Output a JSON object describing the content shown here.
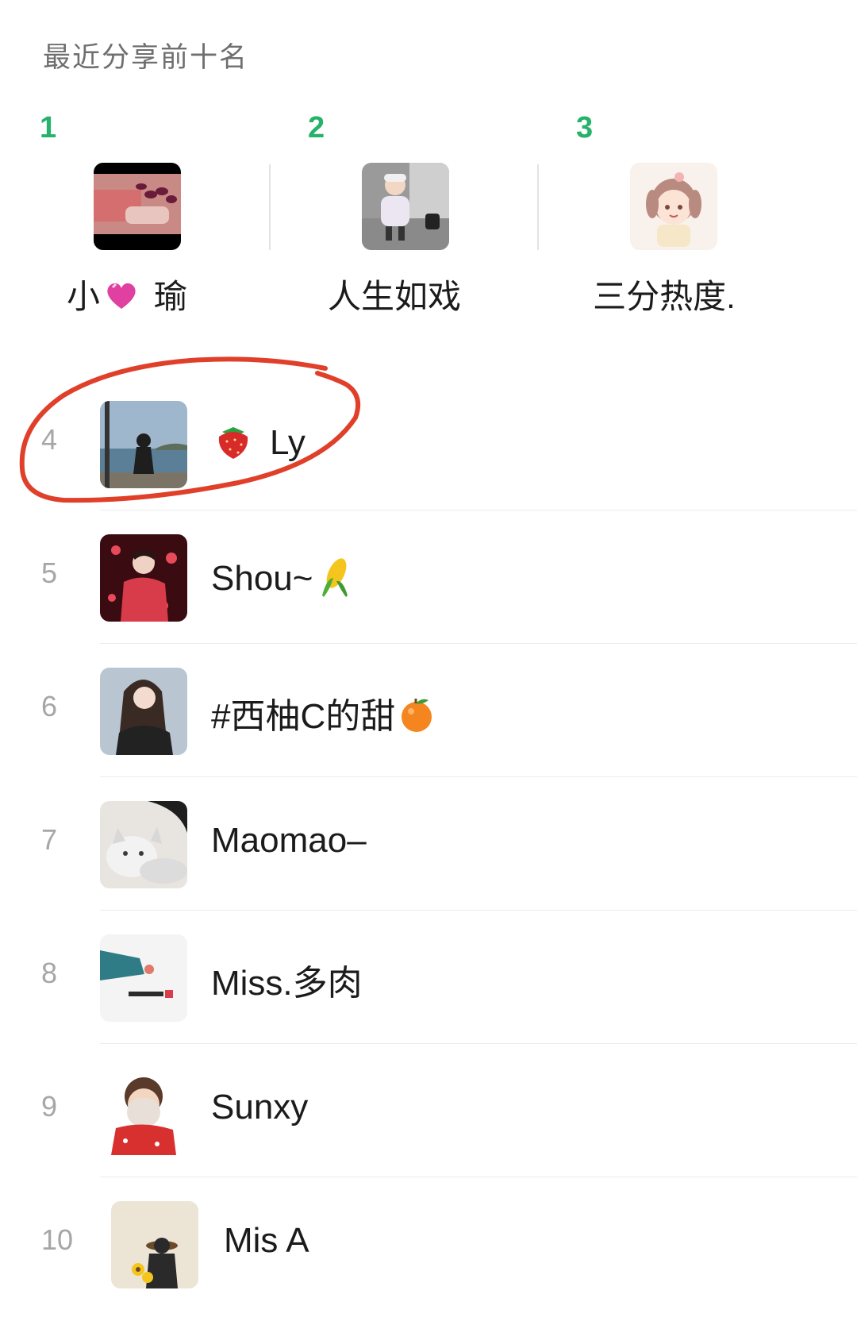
{
  "header": {
    "title": "最近分享前十名"
  },
  "podium": [
    {
      "rank": "1",
      "name_prefix": "小",
      "name_suffix": "瑜",
      "emoji": "heart-icon"
    },
    {
      "rank": "2",
      "name": "人生如戏"
    },
    {
      "rank": "3",
      "name": "三分热度."
    }
  ],
  "list": [
    {
      "rank": "4",
      "name": "Ly",
      "emoji": "strawberry-icon"
    },
    {
      "rank": "5",
      "name": "Shou~",
      "emoji": "corn-icon"
    },
    {
      "rank": "6",
      "name": "#西柚C的甜",
      "emoji": "orange-icon"
    },
    {
      "rank": "7",
      "name": "Maomao–"
    },
    {
      "rank": "8",
      "name": "Miss.多肉"
    },
    {
      "rank": "9",
      "name": "Sunxy"
    },
    {
      "rank": "10",
      "name": "Mis A"
    }
  ],
  "colors": {
    "accent_rank": "#25b26a",
    "annotation": "#e0402a"
  }
}
